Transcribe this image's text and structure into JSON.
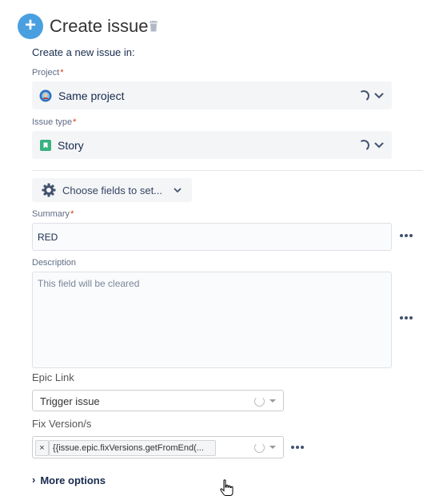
{
  "header": {
    "title": "Create issue",
    "subtitle": "Create a new issue in:"
  },
  "project": {
    "label": "Project",
    "required_mark": "*",
    "value": "Same project"
  },
  "issue_type": {
    "label": "Issue type",
    "required_mark": "*",
    "value": "Story"
  },
  "choose_fields": {
    "label": "Choose fields to set..."
  },
  "summary": {
    "label": "Summary",
    "required_mark": "*",
    "value": "RED"
  },
  "description": {
    "label": "Description",
    "placeholder": "This field will be cleared"
  },
  "epic_link": {
    "label": "Epic Link",
    "value": "Trigger issue"
  },
  "fix_versions": {
    "label": "Fix Version/s",
    "tag_remove": "×",
    "tag_value": "{{issue.epic.fixVersions.getFromEnd(..."
  },
  "more_options": {
    "chevron": "›",
    "label": "More options"
  },
  "colors": {
    "accent": "#4a9fe0",
    "story_icon": "#36b37e",
    "required": "#de350b"
  },
  "icons": [
    "add-icon",
    "trash-icon",
    "project-avatar-icon",
    "story-icon",
    "gear-icon",
    "chevron-down-icon",
    "more-icon",
    "hand-cursor-icon"
  ]
}
